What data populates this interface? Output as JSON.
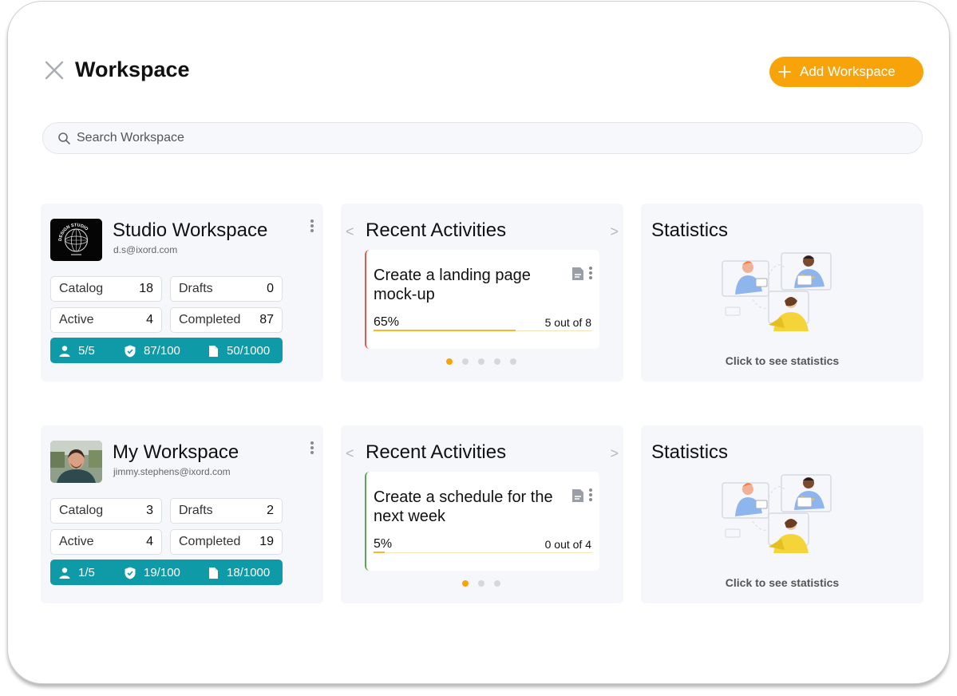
{
  "header": {
    "title": "Workspace",
    "add_label": "Add Workspace"
  },
  "search": {
    "placeholder": "Search Workspace"
  },
  "colors": {
    "accent": "#f9a30b",
    "usage_bar": "#0e9aa7"
  },
  "rows": [
    {
      "workspace": {
        "name": "Studio Workspace",
        "email": "d.s@ixord.com",
        "logo": "design-studio-logo",
        "catalog_label": "Catalog",
        "catalog": "18",
        "drafts_label": "Drafts",
        "drafts": "0",
        "active_label": "Active",
        "active": "4",
        "completed_label": "Completed",
        "completed": "87",
        "users": "5/5",
        "badges": "87/100",
        "files": "50/1000"
      },
      "activity": {
        "title": "Recent Activities",
        "task_title": "Create a landing page mock-up",
        "percent_label": "65%",
        "progress": 0.65,
        "count": "5 out of 8",
        "border_color": "#e05a4a",
        "dots": 5,
        "active_dot": 0
      },
      "statistics": {
        "title": "Statistics",
        "link": "Click to see statistics"
      }
    },
    {
      "workspace": {
        "name": "My Workspace",
        "email": "jimmy.stephens@ixord.com",
        "logo": "user-avatar-photo",
        "catalog_label": "Catalog",
        "catalog": "3",
        "drafts_label": "Drafts",
        "drafts": "2",
        "active_label": "Active",
        "active": "4",
        "completed_label": "Completed",
        "completed": "19",
        "users": "1/5",
        "badges": "19/100",
        "files": "18/1000"
      },
      "activity": {
        "title": "Recent Activities",
        "task_title": "Create a schedule for the next week",
        "percent_label": "5%",
        "progress": 0.05,
        "count": "0 out of 4",
        "border_color": "#5aa55a",
        "dots": 3,
        "active_dot": 0
      },
      "statistics": {
        "title": "Statistics",
        "link": "Click to see statistics"
      }
    }
  ]
}
